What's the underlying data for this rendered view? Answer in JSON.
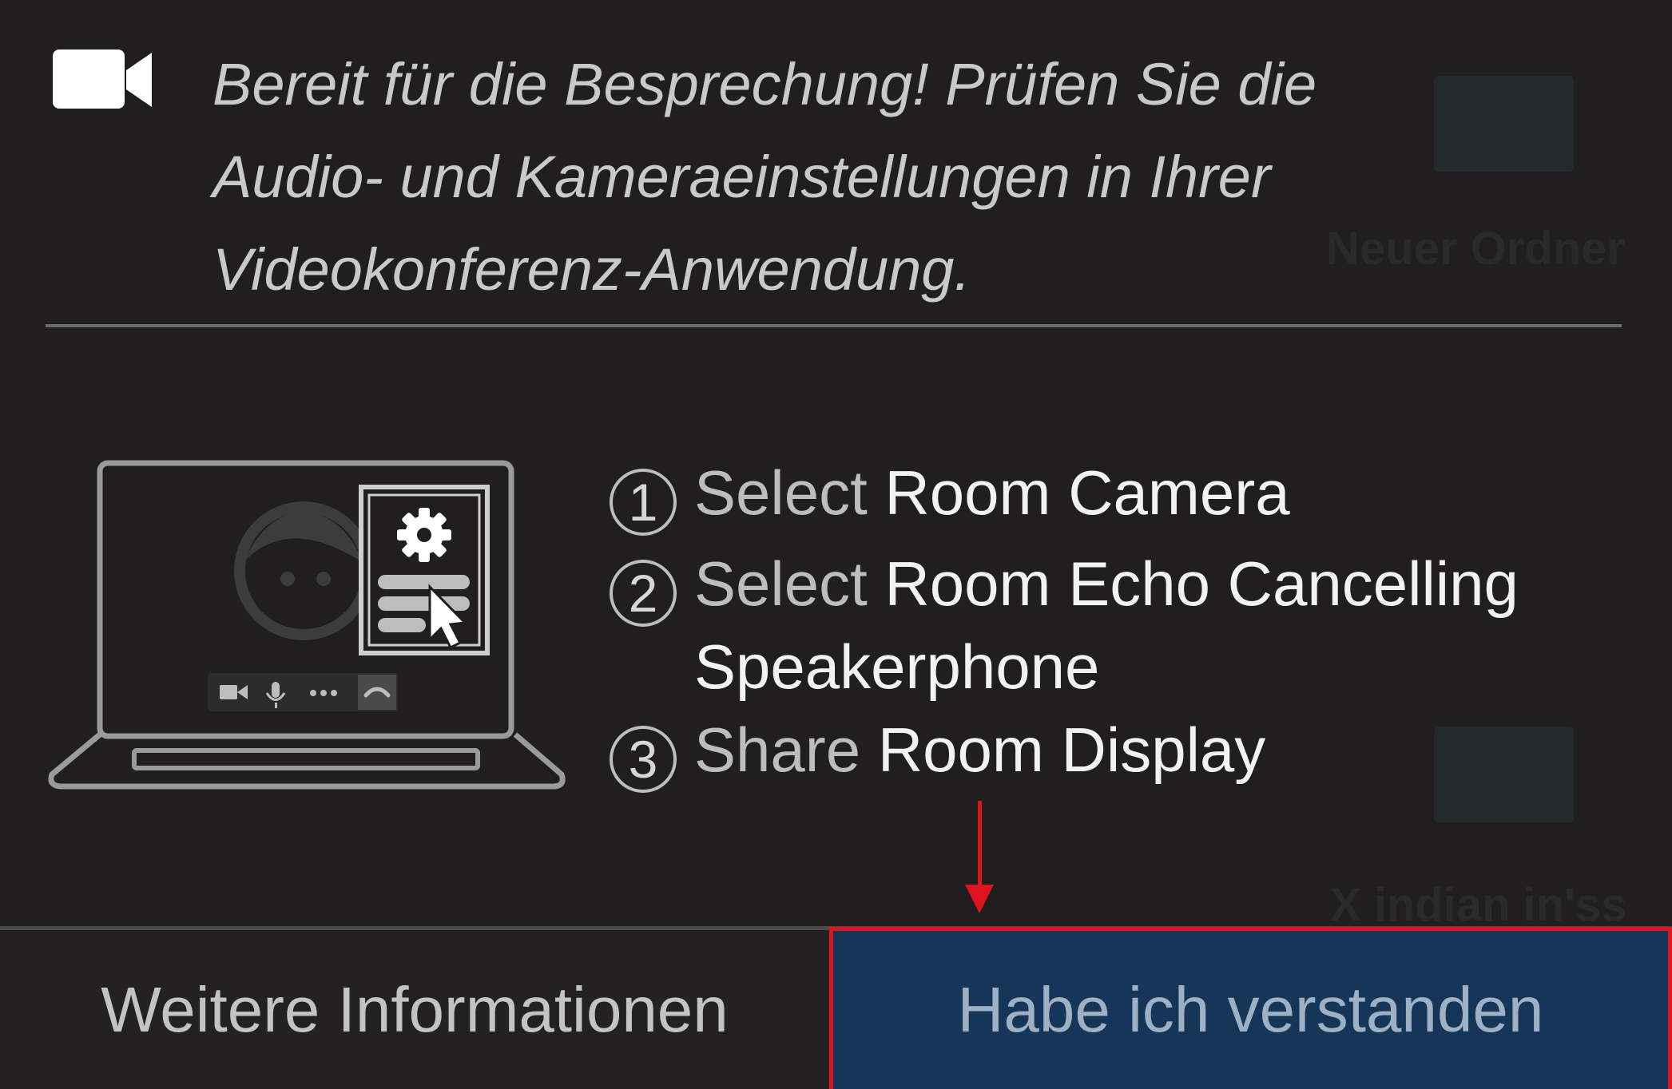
{
  "background": {
    "folder_label_1": "Neuer Ordner",
    "folder_label_2": "X indian in'ss"
  },
  "header": {
    "icon": "video-camera-icon",
    "message": "Bereit für die Besprechung! Prüfen Sie die Audio- und Kameraeinstellungen in Ihrer Videokonferenz-Anwendung."
  },
  "illustration": {
    "icon": "laptop-settings-illustration"
  },
  "steps": [
    {
      "number": "1",
      "verb": "Select",
      "target": "Room Camera"
    },
    {
      "number": "2",
      "verb": "Select",
      "target": "Room Echo Cancelling",
      "target_line2": "Speakerphone"
    },
    {
      "number": "3",
      "verb": "Share",
      "target": "Room Display"
    }
  ],
  "footer": {
    "more_info_label": "Weitere Informationen",
    "confirm_label": "Habe ich verstanden"
  },
  "colors": {
    "panel_bg": "#201e1f",
    "confirm_bg": "#163659",
    "highlight": "#e0141e"
  }
}
